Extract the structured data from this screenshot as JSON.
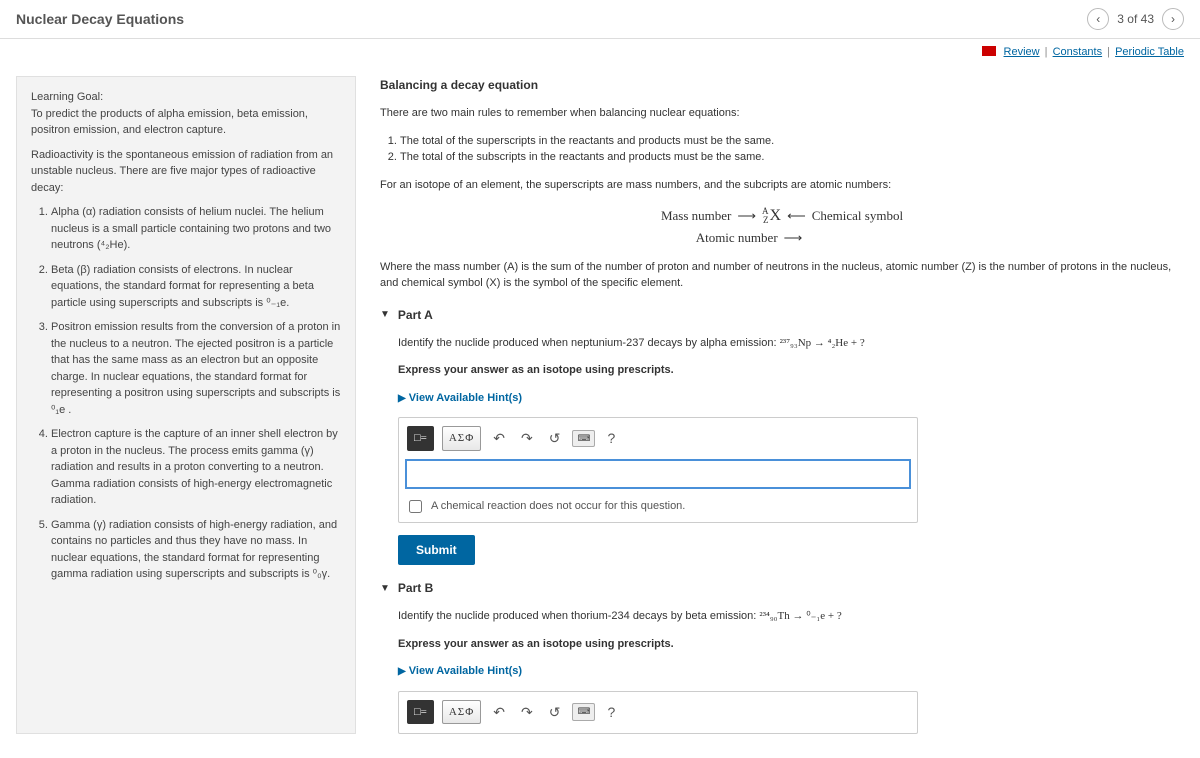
{
  "header": {
    "title": "Nuclear Decay Equations",
    "pager": "3 of 43"
  },
  "linkbar": {
    "review": "Review",
    "constants": "Constants",
    "periodic": "Periodic Table"
  },
  "left": {
    "lg_label": "Learning Goal:",
    "lg_text": "To predict the products of alpha emission, beta emission, positron emission, and electron capture.",
    "intro": "Radioactivity is the spontaneous emission of radiation from an unstable nucleus. There are five major types of radioactive decay:",
    "items": [
      "Alpha (α) radiation consists of helium nuclei. The helium nucleus is a small particle containing two protons and two neutrons (⁴₂He).",
      "Beta (β) radiation consists of electrons. In nuclear equations, the standard format for representing a beta particle using superscripts and subscripts is ⁰₋₁e.",
      "Positron emission results from the conversion of a proton in the nucleus to a neutron. The ejected positron is a particle that has the same mass as an electron but an opposite charge. In nuclear equations, the standard format for representing a positron using superscripts and subscripts is ⁰₁e .",
      "Electron capture is the capture of an inner shell electron by a proton in the nucleus. The process emits gamma (γ) radiation and results in a proton converting to a neutron. Gamma radiation consists of high-energy electromagnetic radiation.",
      "Gamma (γ) radiation consists of high-energy radiation, and contains no particles and thus they have no mass. In nuclear equations, the standard format for representing gamma radiation using superscripts and subscripts is ⁰₀γ."
    ]
  },
  "right": {
    "bal_title": "Balancing a decay equation",
    "bal_intro": "There are two main rules to remember when balancing nuclear equations:",
    "rule1": "The total of the superscripts in the reactants and products must be the same.",
    "rule2": "The total of the subscripts in the reactants and products must be the same.",
    "iso_line": "For an isotope of an element, the superscripts are mass numbers, and the subcripts are atomic numbers:",
    "notation_mass": "Mass number",
    "notation_atomic": "Atomic number",
    "notation_chem": "Chemical symbol",
    "where": "Where the mass number (A) is the sum of the number of proton and number of neutrons in the nucleus, atomic number (Z) is the number of protons in the nucleus, and chemical symbol (X) is the symbol of the specific element.",
    "partA": {
      "label": "Part A",
      "q_prefix": "Identify the nuclide produced when neptunium-237 decays by alpha emission:",
      "q_eq": "²³⁷₉₃Np → ⁴₂He + ?",
      "express": "Express your answer as an isotope using prescripts.",
      "hints": "View Available Hint(s)",
      "chk": "A chemical reaction does not occur for this question.",
      "submit": "Submit"
    },
    "partB": {
      "label": "Part B",
      "q_prefix": "Identify the nuclide produced when thorium-234 decays by beta emission:",
      "q_eq": "²³⁴₉₀Th → ⁰₋₁e + ?",
      "express": "Express your answer as an isotope using prescripts.",
      "hints": "View Available Hint(s)"
    },
    "toolbar": {
      "templates": "□=",
      "greek": "ΑΣΦ",
      "help": "?"
    }
  }
}
